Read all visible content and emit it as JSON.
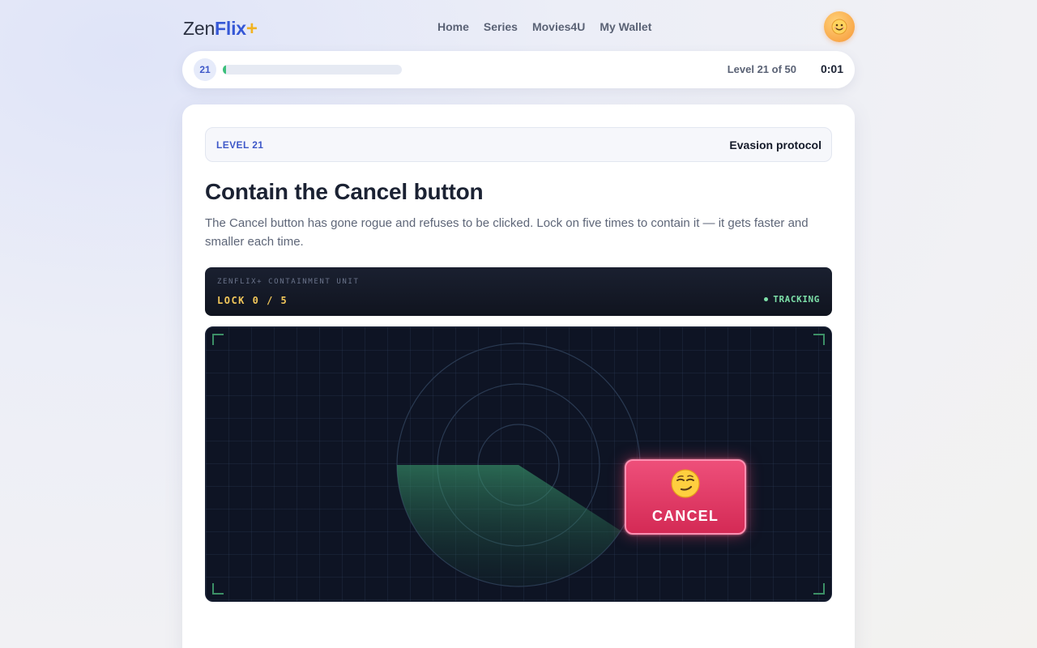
{
  "header": {
    "logo_light": "Zen",
    "logo_bold": "Flix",
    "logo_plus": "+",
    "nav": [
      {
        "label": "Home"
      },
      {
        "label": "Series"
      },
      {
        "label": "Movies4U"
      },
      {
        "label": "My Wallet"
      }
    ],
    "avatar_icon": "smiling-face-avatar-icon"
  },
  "progress": {
    "badge": "21",
    "fraction": 0.02,
    "level_text": "Level 21 of 50",
    "timer": "0:01"
  },
  "level": {
    "tag": "LEVEL 21",
    "name": "Evasion protocol"
  },
  "challenge": {
    "title": "Contain the Cancel button",
    "description": "The Cancel button has gone rogue and refuses to be clicked. Lock on five times to contain it — it gets faster and smaller each time."
  },
  "unit": {
    "label": "ZENFLIX+ CONTAINMENT UNIT",
    "lock_count": "LOCK 0 / 5",
    "status": "TRACKING"
  },
  "cancel_button": {
    "label": "CANCEL",
    "icon": "smirking-face-icon"
  },
  "colors": {
    "accent": "#3557d6",
    "plus": "#f2b321",
    "progress_fill": "#3bbf7b",
    "cancel": "#d42a55",
    "tracking": "#7de0a8",
    "lock": "#f2c75a"
  }
}
